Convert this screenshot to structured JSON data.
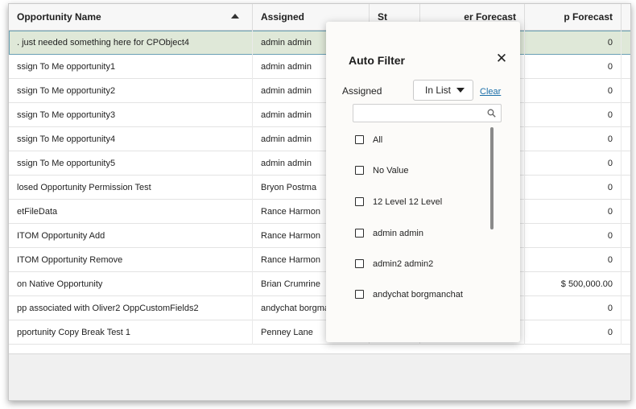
{
  "grid": {
    "columns": [
      {
        "label": "Opportunity Name"
      },
      {
        "label": "Assigned"
      },
      {
        "label": "St"
      },
      {
        "label": "er Forecast"
      },
      {
        "label": "p Forecast"
      }
    ],
    "rows": [
      {
        "name": ". just needed something here for CPObject4",
        "assigned": "admin admin",
        "forecast": "0",
        "selected": true
      },
      {
        "name": "ssign To Me opportunity1",
        "assigned": "admin admin",
        "forecast": "0"
      },
      {
        "name": "ssign To Me opportunity2",
        "assigned": "admin admin",
        "forecast": "0"
      },
      {
        "name": "ssign To Me opportunity3",
        "assigned": "admin admin",
        "forecast": "0"
      },
      {
        "name": "ssign To Me opportunity4",
        "assigned": "admin admin",
        "forecast": "0"
      },
      {
        "name": "ssign To Me opportunity5",
        "assigned": "admin admin",
        "forecast": "0"
      },
      {
        "name": "losed Opportunity Permission Test",
        "assigned": "Bryon Postma",
        "forecast": "0"
      },
      {
        "name": "etFileData",
        "assigned": "Rance Harmon",
        "forecast": "0"
      },
      {
        "name": "ITOM Opportunity Add",
        "assigned": "Rance Harmon",
        "forecast": "0"
      },
      {
        "name": "ITOM Opportunity Remove",
        "assigned": "Rance Harmon",
        "forecast": "0"
      },
      {
        "name": "on Native Opportunity",
        "assigned": "Brian Crumrine",
        "forecast": "$ 500,000.00"
      },
      {
        "name": "pp associated with Oliver2 OppCustomFields2",
        "assigned": "andychat borgma",
        "forecast": "0"
      },
      {
        "name": "pportunity Copy Break Test 1",
        "assigned": "Penney Lane",
        "forecast": "0"
      }
    ]
  },
  "auto_filter": {
    "title": "Auto Filter",
    "close_glyph": "✕",
    "field_label": "Assigned",
    "operator": "In List",
    "clear_label": "Clear",
    "search_value": "",
    "options": [
      {
        "label": "All",
        "checked": false
      },
      {
        "label": "No Value",
        "checked": false
      },
      {
        "label": "12 Level 12 Level",
        "checked": false
      },
      {
        "label": "admin admin",
        "checked": false
      },
      {
        "label": "admin2 admin2",
        "checked": false
      },
      {
        "label": "andychat borgmanchat",
        "checked": false
      }
    ]
  },
  "icons": {
    "sort": "sort-ascending-icon",
    "close": "close-icon",
    "dropdown": "caret-down-icon",
    "search": "search-icon"
  },
  "colors": {
    "selected_row": "#dfe8d8",
    "link": "#1a6ea8"
  }
}
